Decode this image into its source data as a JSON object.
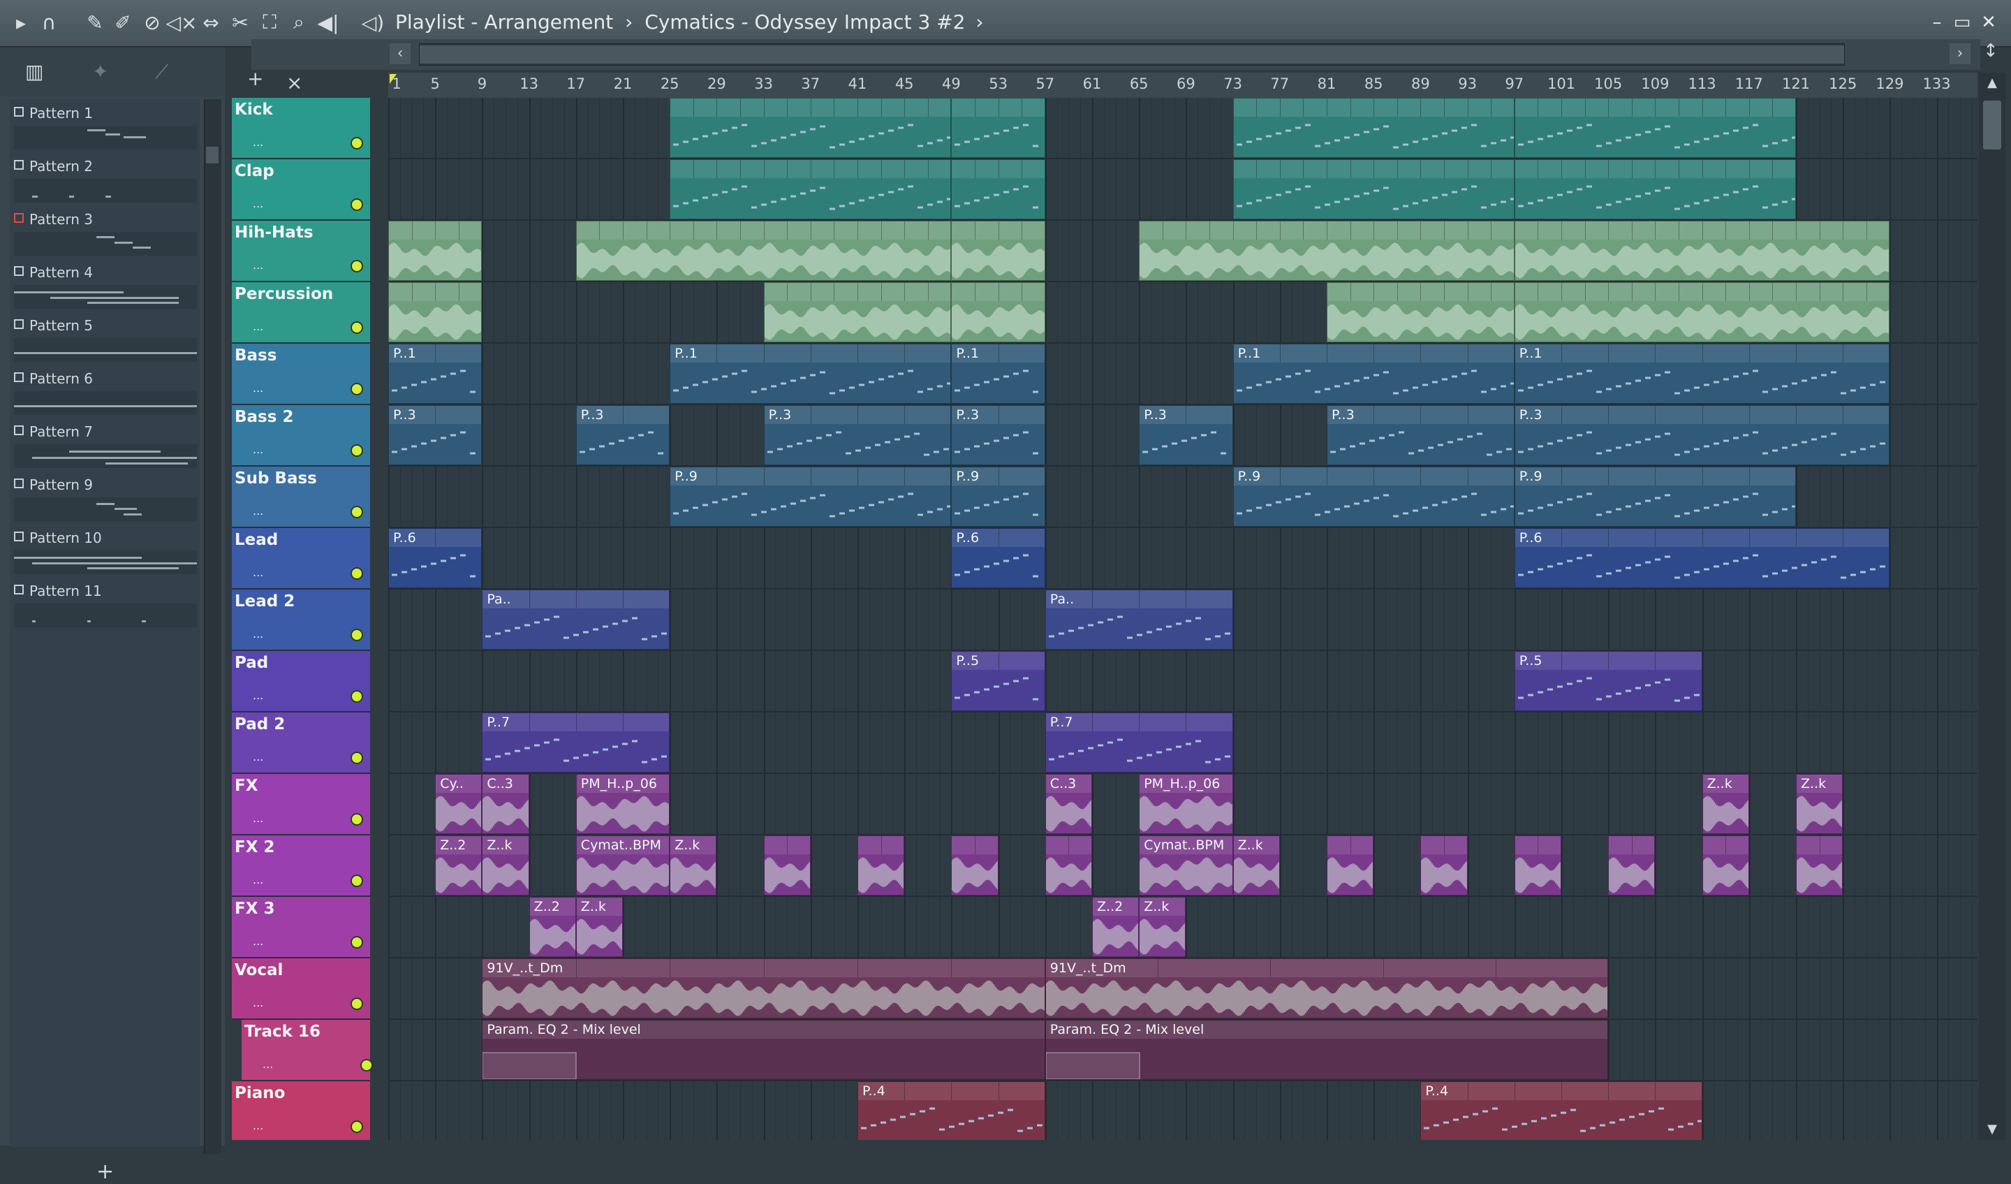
{
  "window": {
    "title_prefix": "Playlist - Arrangement",
    "project_name": "Cymatics - Odyssey Impact 3 #2",
    "sep": "›",
    "minimize": "–",
    "maximize": "▭",
    "close": "✕"
  },
  "toolbar_icons": [
    "play-arrow-icon",
    "magnet-icon",
    "pencil-icon",
    "brush-icon",
    "delete-icon",
    "mute-icon",
    "slip-icon",
    "slice-icon",
    "select-icon",
    "zoom-icon",
    "playback-icon",
    "speaker-icon"
  ],
  "ruler": {
    "bars": [
      "1",
      "5",
      "9",
      "13",
      "17",
      "21",
      "25",
      "29",
      "33",
      "37",
      "41",
      "45",
      "49",
      "53",
      "57",
      "61",
      "65",
      "69",
      "73",
      "77",
      "81",
      "85",
      "89",
      "93",
      "97",
      "101",
      "105",
      "109",
      "113",
      "117",
      "121",
      "125",
      "129",
      "133"
    ]
  },
  "patterns": [
    {
      "label": "Pattern 1",
      "current": false
    },
    {
      "label": "Pattern 2",
      "current": false
    },
    {
      "label": "Pattern 3",
      "current": true
    },
    {
      "label": "Pattern 4",
      "current": false
    },
    {
      "label": "Pattern 5",
      "current": false
    },
    {
      "label": "Pattern 6",
      "current": false
    },
    {
      "label": "Pattern 7",
      "current": false
    },
    {
      "label": "Pattern 9",
      "current": false
    },
    {
      "label": "Pattern 10",
      "current": false
    },
    {
      "label": "Pattern 11",
      "current": false
    }
  ],
  "add_label": "+",
  "tracks": [
    {
      "name": "Kick",
      "color": "#2a9a8c",
      "clip": "#2f7f78",
      "kind": "pattern"
    },
    {
      "name": "Clap",
      "color": "#2a9a8c",
      "clip": "#2f7f78",
      "kind": "pattern"
    },
    {
      "name": "Hih-Hats",
      "color": "#2f9a8a",
      "clip": "#6f9f7c",
      "kind": "audio"
    },
    {
      "name": "Percussion",
      "color": "#2f9a8a",
      "clip": "#6f9f7c",
      "kind": "audio"
    },
    {
      "name": "Bass",
      "color": "#357aa0",
      "clip": "#305a78",
      "kind": "pattern"
    },
    {
      "name": "Bass 2",
      "color": "#357aa0",
      "clip": "#305a78",
      "kind": "pattern"
    },
    {
      "name": "Sub Bass",
      "color": "#3b6fa2",
      "clip": "#305a78",
      "kind": "pattern"
    },
    {
      "name": "Lead",
      "color": "#3b5aa8",
      "clip": "#2f4a8a",
      "kind": "pattern"
    },
    {
      "name": "Lead 2",
      "color": "#3b5aa8",
      "clip": "#3a4a8c",
      "kind": "pattern"
    },
    {
      "name": "Pad",
      "color": "#5a45b0",
      "clip": "#4a3f95",
      "kind": "pattern"
    },
    {
      "name": "Pad 2",
      "color": "#6a45b0",
      "clip": "#4a3f95",
      "kind": "pattern"
    },
    {
      "name": "FX",
      "color": "#9a3fb0",
      "clip": "#7a3a8c",
      "kind": "audio"
    },
    {
      "name": "FX 2",
      "color": "#9a3fb0",
      "clip": "#7a3a8c",
      "kind": "audio"
    },
    {
      "name": "FX 3",
      "color": "#a03ea8",
      "clip": "#7a3a8c",
      "kind": "audio"
    },
    {
      "name": "Vocal",
      "color": "#b03a8a",
      "clip": "#6a3a5c",
      "kind": "audio"
    },
    {
      "name": "Track 16",
      "color": "#b8407e",
      "clip": "#5a3050",
      "kind": "automation"
    },
    {
      "name": "Piano",
      "color": "#c03a6a",
      "clip": "#7a3448",
      "kind": "pattern"
    }
  ],
  "clips": [
    {
      "track": 0,
      "start": 25,
      "end": 49,
      "label": "",
      "n": 12
    },
    {
      "track": 0,
      "start": 49,
      "end": 57,
      "label": "",
      "n": 4
    },
    {
      "track": 0,
      "start": 73,
      "end": 97,
      "label": "",
      "n": 12
    },
    {
      "track": 0,
      "start": 97,
      "end": 121,
      "label": "",
      "n": 12
    },
    {
      "track": 1,
      "start": 25,
      "end": 49,
      "label": "",
      "n": 12
    },
    {
      "track": 1,
      "start": 49,
      "end": 57,
      "label": "",
      "n": 4
    },
    {
      "track": 1,
      "start": 73,
      "end": 97,
      "label": "",
      "n": 12
    },
    {
      "track": 1,
      "start": 97,
      "end": 121,
      "label": "",
      "n": 12
    },
    {
      "track": 2,
      "start": 1,
      "end": 9,
      "label": "",
      "n": 4
    },
    {
      "track": 2,
      "start": 17,
      "end": 49,
      "label": "",
      "n": 16
    },
    {
      "track": 2,
      "start": 49,
      "end": 57,
      "label": "",
      "n": 4
    },
    {
      "track": 2,
      "start": 65,
      "end": 97,
      "label": "",
      "n": 16
    },
    {
      "track": 2,
      "start": 97,
      "end": 129,
      "label": "",
      "n": 16
    },
    {
      "track": 3,
      "start": 1,
      "end": 9,
      "label": "",
      "n": 4
    },
    {
      "track": 3,
      "start": 33,
      "end": 49,
      "label": "",
      "n": 8
    },
    {
      "track": 3,
      "start": 49,
      "end": 57,
      "label": "",
      "n": 4
    },
    {
      "track": 3,
      "start": 81,
      "end": 97,
      "label": "",
      "n": 8
    },
    {
      "track": 3,
      "start": 97,
      "end": 129,
      "label": "",
      "n": 16
    },
    {
      "track": 4,
      "start": 1,
      "end": 9,
      "label": "P..1",
      "n": 2
    },
    {
      "track": 4,
      "start": 25,
      "end": 49,
      "label": "P..1",
      "n": 6
    },
    {
      "track": 4,
      "start": 49,
      "end": 57,
      "label": "P..1",
      "n": 2
    },
    {
      "track": 4,
      "start": 73,
      "end": 97,
      "label": "P..1",
      "n": 6
    },
    {
      "track": 4,
      "start": 97,
      "end": 129,
      "label": "P..1",
      "n": 8
    },
    {
      "track": 5,
      "start": 1,
      "end": 9,
      "label": "P..3",
      "n": 2
    },
    {
      "track": 5,
      "start": 17,
      "end": 25,
      "label": "P..3",
      "n": 2
    },
    {
      "track": 5,
      "start": 33,
      "end": 49,
      "label": "P..3",
      "n": 4
    },
    {
      "track": 5,
      "start": 49,
      "end": 57,
      "label": "P..3",
      "n": 2
    },
    {
      "track": 5,
      "start": 65,
      "end": 73,
      "label": "P..3",
      "n": 2
    },
    {
      "track": 5,
      "start": 81,
      "end": 97,
      "label": "P..3",
      "n": 4
    },
    {
      "track": 5,
      "start": 97,
      "end": 129,
      "label": "P..3",
      "n": 8
    },
    {
      "track": 6,
      "start": 25,
      "end": 49,
      "label": "P..9",
      "n": 6
    },
    {
      "track": 6,
      "start": 49,
      "end": 57,
      "label": "P..9",
      "n": 2
    },
    {
      "track": 6,
      "start": 73,
      "end": 97,
      "label": "P..9",
      "n": 6
    },
    {
      "track": 6,
      "start": 97,
      "end": 121,
      "label": "P..9",
      "n": 6
    },
    {
      "track": 7,
      "start": 1,
      "end": 9,
      "label": "P..6",
      "n": 2
    },
    {
      "track": 7,
      "start": 49,
      "end": 57,
      "label": "P..6",
      "n": 2
    },
    {
      "track": 7,
      "start": 97,
      "end": 129,
      "label": "P..6",
      "n": 8
    },
    {
      "track": 8,
      "start": 9,
      "end": 25,
      "label": "Pa..",
      "n": 4
    },
    {
      "track": 8,
      "start": 57,
      "end": 73,
      "label": "Pa..",
      "n": 4
    },
    {
      "track": 9,
      "start": 49,
      "end": 57,
      "label": "P..5",
      "n": 2
    },
    {
      "track": 9,
      "start": 97,
      "end": 113,
      "label": "P..5",
      "n": 4
    },
    {
      "track": 10,
      "start": 9,
      "end": 25,
      "label": "P..7",
      "n": 4
    },
    {
      "track": 10,
      "start": 57,
      "end": 73,
      "label": "P..7",
      "n": 4
    },
    {
      "track": 11,
      "start": 5,
      "end": 9,
      "label": "Cy..",
      "n": 1
    },
    {
      "track": 11,
      "start": 9,
      "end": 13,
      "label": "C..3",
      "n": 1
    },
    {
      "track": 11,
      "start": 17,
      "end": 25,
      "label": "PM_H..p_06",
      "n": 1
    },
    {
      "track": 11,
      "start": 57,
      "end": 61,
      "label": "C..3",
      "n": 1
    },
    {
      "track": 11,
      "start": 65,
      "end": 73,
      "label": "PM_H..p_06",
      "n": 1
    },
    {
      "track": 11,
      "start": 113,
      "end": 117,
      "label": "Z..k",
      "n": 1
    },
    {
      "track": 11,
      "start": 121,
      "end": 125,
      "label": "Z..k",
      "n": 1
    },
    {
      "track": 12,
      "start": 5,
      "end": 9,
      "label": "Z..2",
      "n": 1
    },
    {
      "track": 12,
      "start": 9,
      "end": 13,
      "label": "Z..k",
      "n": 1
    },
    {
      "track": 12,
      "start": 17,
      "end": 25,
      "label": "Cymat..BPM",
      "n": 1
    },
    {
      "track": 12,
      "start": 25,
      "end": 29,
      "label": "Z..k",
      "n": 1
    },
    {
      "track": 12,
      "start": 33,
      "end": 37,
      "label": "",
      "n": 2
    },
    {
      "track": 12,
      "start": 41,
      "end": 45,
      "label": "",
      "n": 2
    },
    {
      "track": 12,
      "start": 49,
      "end": 53,
      "label": "",
      "n": 2
    },
    {
      "track": 12,
      "start": 57,
      "end": 61,
      "label": "",
      "n": 2
    },
    {
      "track": 12,
      "start": 65,
      "end": 73,
      "label": "Cymat..BPM",
      "n": 1
    },
    {
      "track": 12,
      "start": 73,
      "end": 77,
      "label": "Z..k",
      "n": 1
    },
    {
      "track": 12,
      "start": 81,
      "end": 85,
      "label": "",
      "n": 2
    },
    {
      "track": 12,
      "start": 89,
      "end": 93,
      "label": "",
      "n": 2
    },
    {
      "track": 12,
      "start": 97,
      "end": 101,
      "label": "",
      "n": 2
    },
    {
      "track": 12,
      "start": 105,
      "end": 109,
      "label": "",
      "n": 2
    },
    {
      "track": 12,
      "start": 113,
      "end": 117,
      "label": "",
      "n": 2
    },
    {
      "track": 12,
      "start": 121,
      "end": 125,
      "label": "",
      "n": 2
    },
    {
      "track": 13,
      "start": 13,
      "end": 17,
      "label": "Z..2",
      "n": 1
    },
    {
      "track": 13,
      "start": 17,
      "end": 21,
      "label": "Z..k",
      "n": 1
    },
    {
      "track": 13,
      "start": 61,
      "end": 65,
      "label": "Z..2",
      "n": 1
    },
    {
      "track": 13,
      "start": 65,
      "end": 69,
      "label": "Z..k",
      "n": 1
    },
    {
      "track": 14,
      "start": 9,
      "end": 57,
      "label": "91V_..t_Dm",
      "n": 6
    },
    {
      "track": 14,
      "start": 57,
      "end": 105,
      "label": "91V_..t_Dm",
      "n": 5
    },
    {
      "track": 15,
      "start": 9,
      "end": 57,
      "label": "Param. EQ 2 - Mix level",
      "n": 1
    },
    {
      "track": 15,
      "start": 57,
      "end": 105,
      "label": "Param. EQ 2 - Mix level",
      "n": 1
    },
    {
      "track": 16,
      "start": 41,
      "end": 57,
      "label": "P..4",
      "n": 4
    },
    {
      "track": 16,
      "start": 89,
      "end": 113,
      "label": "P..4",
      "n": 6
    }
  ]
}
